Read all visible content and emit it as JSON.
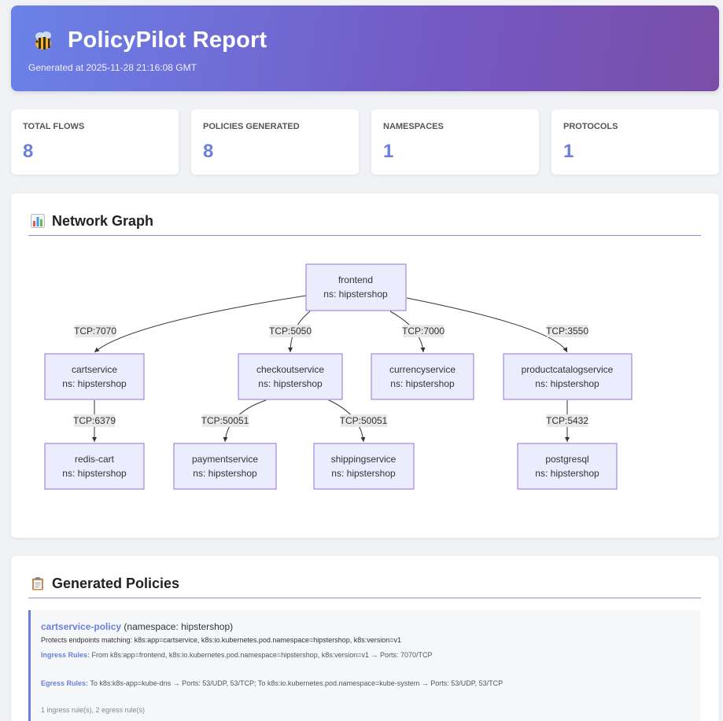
{
  "header": {
    "title": "PolicyPilot Report",
    "generated": "Generated at 2025-11-28 21:16:08 GMT"
  },
  "stats": [
    {
      "label": "TOTAL FLOWS",
      "value": "8"
    },
    {
      "label": "POLICIES GENERATED",
      "value": "8"
    },
    {
      "label": "NAMESPACES",
      "value": "1"
    },
    {
      "label": "PROTOCOLS",
      "value": "1"
    }
  ],
  "graph": {
    "title": "Network Graph",
    "nodes": {
      "frontend": {
        "name": "frontend",
        "ns": "ns: hipstershop"
      },
      "cartservice": {
        "name": "cartservice",
        "ns": "ns: hipstershop"
      },
      "checkoutservice": {
        "name": "checkoutservice",
        "ns": "ns: hipstershop"
      },
      "currencyservice": {
        "name": "currencyservice",
        "ns": "ns: hipstershop"
      },
      "productcatalogservice": {
        "name": "productcatalogservice",
        "ns": "ns: hipstershop"
      },
      "redis_cart": {
        "name": "redis-cart",
        "ns": "ns: hipstershop"
      },
      "paymentservice": {
        "name": "paymentservice",
        "ns": "ns: hipstershop"
      },
      "shippingservice": {
        "name": "shippingservice",
        "ns": "ns: hipstershop"
      },
      "postgresql": {
        "name": "postgresql",
        "ns": "ns: hipstershop"
      }
    },
    "edges": {
      "fe_cart": "TCP:7070",
      "fe_checkout": "TCP:5050",
      "fe_currency": "TCP:7000",
      "fe_product": "TCP:3550",
      "cart_redis": "TCP:6379",
      "checkout_payment": "TCP:50051",
      "checkout_shipping": "TCP:50051",
      "product_postgres": "TCP:5432"
    }
  },
  "policies": {
    "title": "Generated Policies",
    "items": [
      {
        "name": "cartservice-policy",
        "namespace": "(namespace: hipstershop)",
        "protects": "Protects endpoints matching: k8s:app=cartservice, k8s:io.kubernetes.pod.namespace=hipstershop, k8s:version=v1",
        "ingress_label": "Ingress Rules:",
        "ingress": "From k8s:app=frontend, k8s:io.kubernetes.pod.namespace=hipstershop, k8s:version=v1 → Ports: 7070/TCP",
        "egress_label": "Egress Rules:",
        "egress": "To k8s:k8s-app=kube-dns → Ports: 53/UDP, 53/TCP; To k8s:io.kubernetes.pod.namespace=kube-system → Ports: 53/UDP, 53/TCP",
        "summary": "1 ingress rule(s), 2 egress rule(s)"
      }
    ]
  },
  "colors": {
    "accent": "#6a7fdd",
    "node_fill": "#ececff",
    "node_stroke": "#9370db",
    "edge_label_bg": "#e8e8e8"
  }
}
